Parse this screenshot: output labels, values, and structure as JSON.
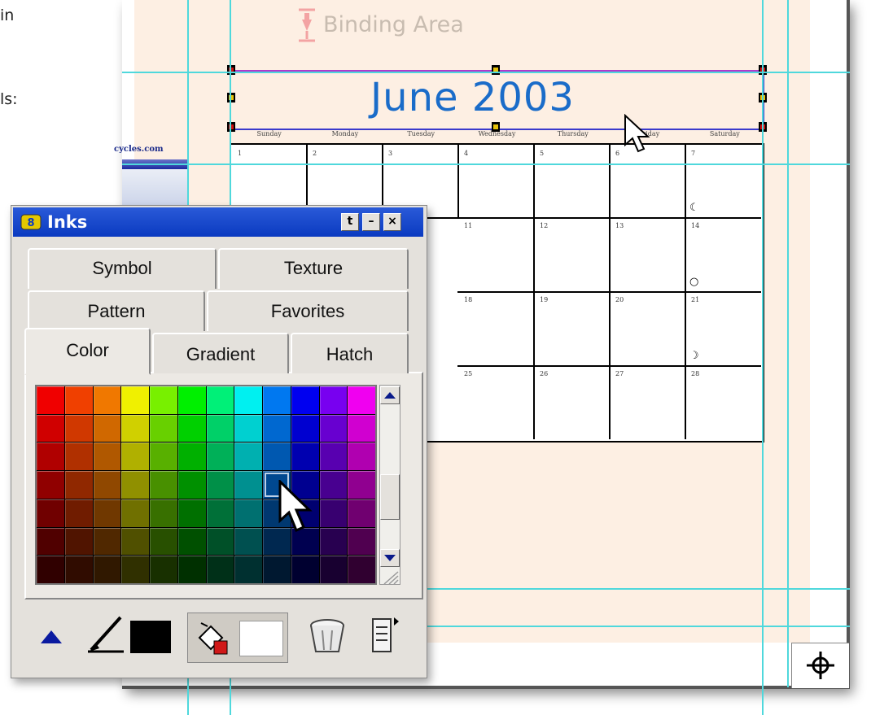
{
  "background_fragments": [
    "in",
    "ls:"
  ],
  "binding_label": "Binding Area",
  "calendar": {
    "title": "June 2003",
    "days": [
      "Sunday",
      "Monday",
      "Tuesday",
      "Wednesday",
      "Thursday",
      "Friday",
      "Saturday"
    ],
    "first_row": [
      "1",
      "2",
      "3",
      "4",
      "5",
      "6",
      "7"
    ],
    "visible_numbers": [
      "11",
      "12",
      "13",
      "14",
      "18",
      "19",
      "20",
      "21",
      "25",
      "26",
      "27",
      "28"
    ],
    "site_url": "cycles.com"
  },
  "inks_panel": {
    "title": "Inks",
    "window_buttons": [
      "t",
      "–",
      "×"
    ],
    "tabs_row1": [
      "Symbol",
      "Texture"
    ],
    "tabs_row2": [
      "Pattern",
      "Favorites"
    ],
    "tabs_row3": [
      "Color",
      "Gradient",
      "Hatch"
    ],
    "active_tab": "Color",
    "palette_colors": [
      [
        "#f00000",
        "#f04000",
        "#f07800",
        "#f0f000",
        "#78f000",
        "#00f000",
        "#00f078",
        "#00f0f0",
        "#0078f0",
        "#0000f0",
        "#7800f0",
        "#f000f0"
      ],
      [
        "#d00000",
        "#d03800",
        "#d06800",
        "#d0d000",
        "#68d000",
        "#00d000",
        "#00d068",
        "#00d0d0",
        "#0068d0",
        "#0000d0",
        "#6800d0",
        "#d000d0"
      ],
      [
        "#b00000",
        "#b03000",
        "#b05800",
        "#b0b000",
        "#58b000",
        "#00b000",
        "#00b058",
        "#00b0b0",
        "#0058b0",
        "#0000b0",
        "#5800b0",
        "#b000b0"
      ],
      [
        "#900000",
        "#902800",
        "#904800",
        "#909000",
        "#489000",
        "#009000",
        "#009048",
        "#009090",
        "#004890",
        "#000090",
        "#480090",
        "#900090"
      ],
      [
        "#700000",
        "#701c00",
        "#703800",
        "#707000",
        "#387000",
        "#007000",
        "#007038",
        "#007070",
        "#003870",
        "#000070",
        "#380070",
        "#700070"
      ],
      [
        "#500000",
        "#501400",
        "#502800",
        "#505000",
        "#285000",
        "#005000",
        "#005028",
        "#005050",
        "#002850",
        "#000050",
        "#280050",
        "#500050"
      ],
      [
        "#300000",
        "#300c00",
        "#301800",
        "#303000",
        "#183000",
        "#003000",
        "#003018",
        "#003030",
        "#001830",
        "#000030",
        "#180030",
        "#300030"
      ]
    ],
    "selected_color": "#004890",
    "pen_color": "#000000",
    "fill_color": "#ffffff",
    "accent_blue": "#0a3ac0"
  }
}
